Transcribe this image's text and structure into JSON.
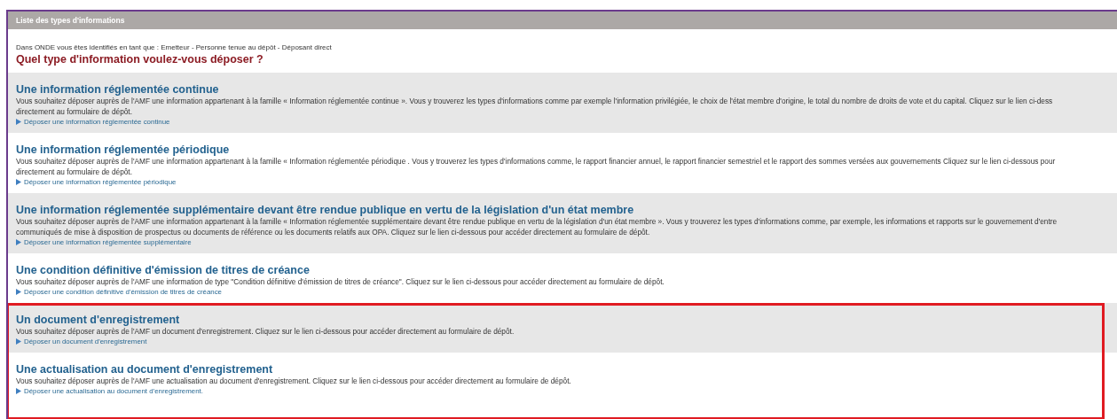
{
  "panel": {
    "title": "Liste des types d'informations"
  },
  "intro": "Dans ONDE vous êtes identifiés en tant que : Emetteur - Personne tenue au dépôt - Déposant direct",
  "question": "Quel type d'information voulez-vous déposer ?",
  "items": [
    {
      "title": "Une information réglementée continue",
      "description": [
        "Vous souhaitez déposer auprès de l'AMF une information appartenant à la famille « Information réglementée continue ». Vous y trouverez les types d'informations comme par exemple l'information privilégiée, le choix de l'état membre d'origine, le total du nombre de droits de vote et du capital. Cliquez sur le lien ci-dess",
        "directement au formulaire de dépôt."
      ],
      "link": "Déposer une information réglementée continue",
      "highlighted": false
    },
    {
      "title": "Une information réglementée périodique",
      "description": [
        "Vous souhaitez déposer auprès de l'AMF une information appartenant à la famille « Information réglementée périodique . Vous y trouverez les types d'informations comme, le rapport financier annuel, le rapport financier semestriel et le rapport des sommes versées aux gouvernements Cliquez sur le lien ci-dessous pour",
        "directement au formulaire de dépôt."
      ],
      "link": "Déposer une information réglementée périodique",
      "highlighted": false
    },
    {
      "title": "Une information réglementée supplémentaire devant être rendue publique en vertu de la législation d'un état membre",
      "description": [
        "Vous souhaitez déposer auprès de l'AMF une information appartenant à la famille « Information réglementée supplémentaire devant être rendue publique en vertu de la législation d'un état membre ». Vous y trouverez les types d'informations comme, par exemple, les informations et rapports sur le gouvernement d'entre",
        "communiqués de mise à disposition de prospectus ou documents de référence ou les documents relatifs aux OPA. Cliquez sur le lien ci-dessous pour accéder directement au formulaire de dépôt."
      ],
      "link": "Déposer une information réglementée supplémentaire",
      "highlighted": false
    },
    {
      "title": "Une condition définitive d'émission de titres de créance",
      "description": [
        "Vous souhaitez déposer auprès de l'AMF une information de type \"Condition définitive d'émission de titres de créance\". Cliquez sur le lien ci-dessous pour accéder directement au formulaire de dépôt."
      ],
      "link": "Déposer une condition définitive d'émission de titres de créance",
      "highlighted": false
    },
    {
      "title": "Un document d'enregistrement",
      "description": [
        "Vous souhaitez déposer auprès de l'AMF un document d'enregistrement. Cliquez sur le lien ci-dessous pour accéder directement au formulaire de dépôt."
      ],
      "link": "Déposer un document d'enregistrement",
      "highlighted": true
    },
    {
      "title": "Une actualisation au document d'enregistrement",
      "description": [
        "Vous souhaitez déposer auprès de l'AMF une actualisation au document d'enregistrement. Cliquez sur le lien ci-dessous pour accéder directement au formulaire de dépôt."
      ],
      "link": "Déposer une actualisation au document d'enregistrement.",
      "highlighted": true
    }
  ]
}
